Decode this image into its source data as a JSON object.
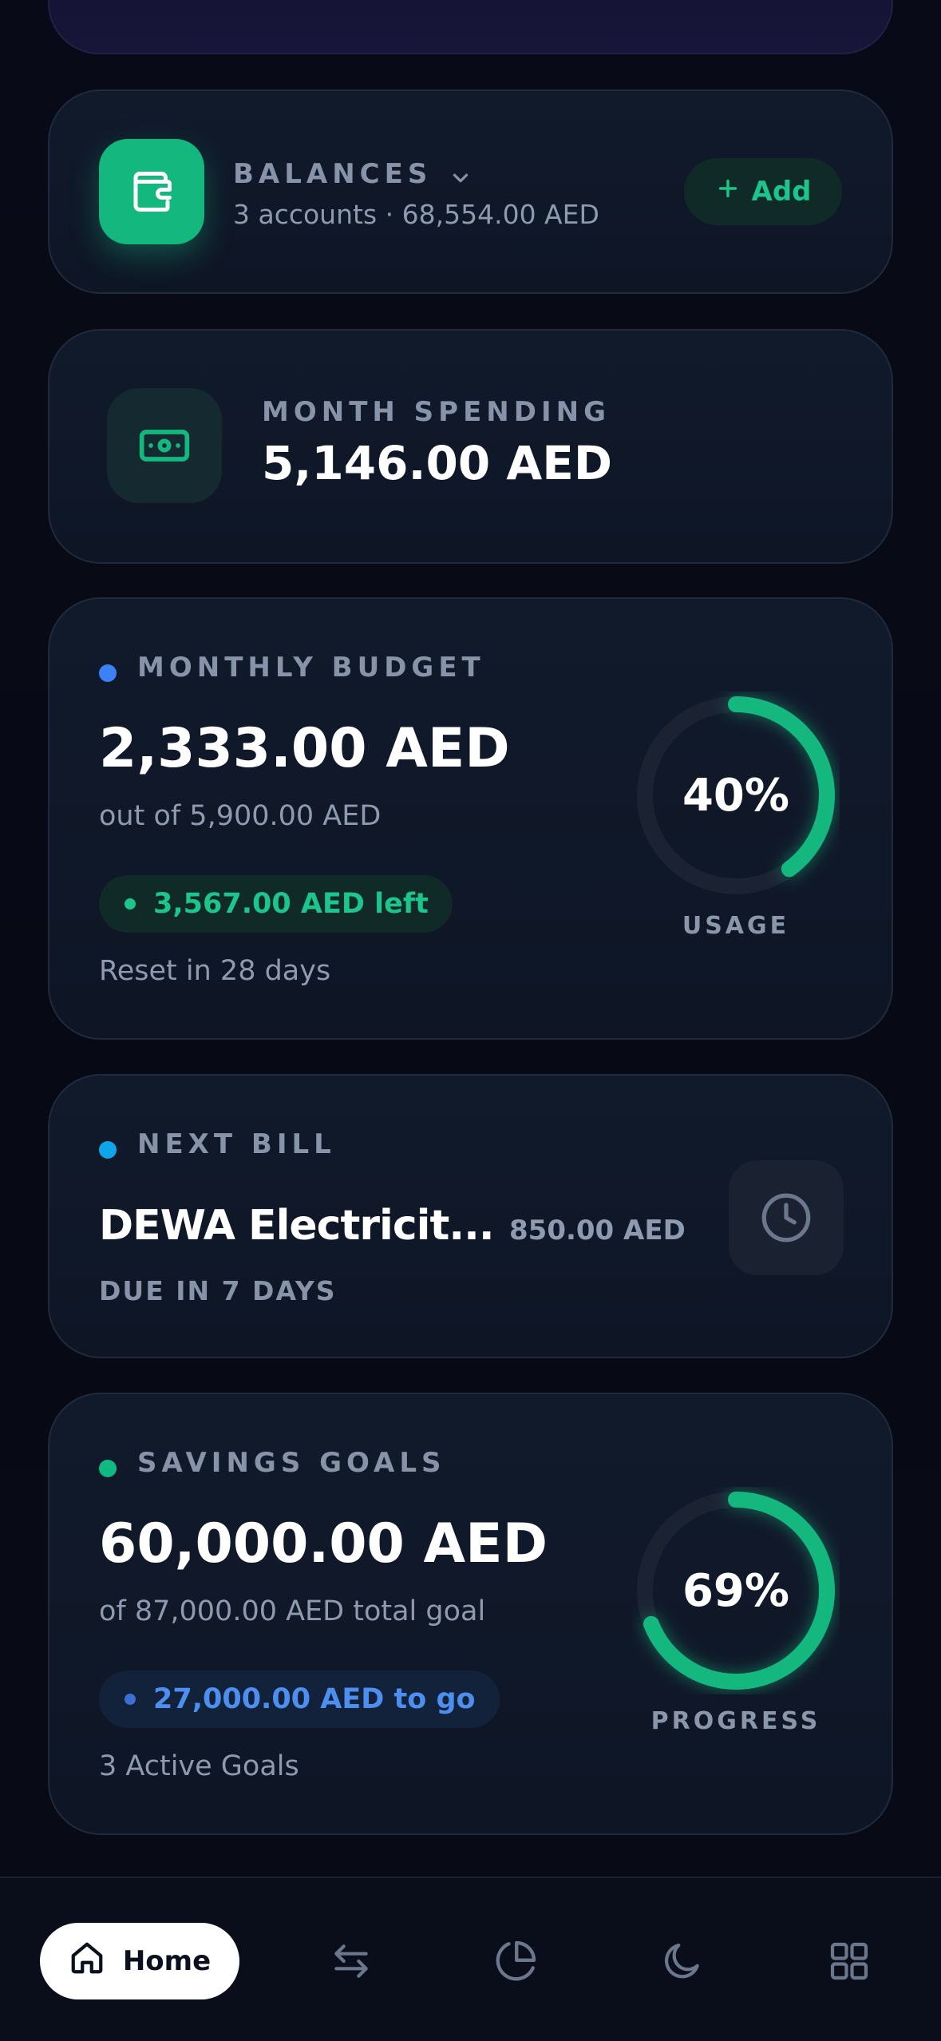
{
  "balances": {
    "title": "BALANCES",
    "subtitle": "3 accounts · 68,554.00 AED",
    "add_label": "Add"
  },
  "spending": {
    "title": "MONTH SPENDING",
    "amount": "5,146.00 AED"
  },
  "budget": {
    "title": "MONTHLY BUDGET",
    "amount": "2,333.00 AED",
    "subtitle": "out of 5,900.00 AED",
    "left_label": "3,567.00 AED left",
    "reset_label": "Reset in 28 days",
    "usage_percent_text": "40%",
    "usage_fraction": 0.4,
    "caption": "USAGE",
    "dot_color": "#3b82f6"
  },
  "bill": {
    "title": "NEXT BILL",
    "name": "DEWA Electricit...",
    "amount": "850.00 AED",
    "due": "DUE IN 7 DAYS",
    "dot_color": "#0ea5e9"
  },
  "savings": {
    "title": "SAVINGS GOALS",
    "amount": "60,000.00 AED",
    "subtitle": "of 87,000.00 AED total goal",
    "to_go_label": "27,000.00 AED to go",
    "active_goals": "3 Active Goals",
    "progress_percent_text": "69%",
    "progress_fraction": 0.69,
    "caption": "PROGRESS",
    "dot_color": "#10b981"
  },
  "nav": {
    "home_label": "Home",
    "items": [
      "home-icon",
      "transfer-icon",
      "pie-chart-icon",
      "moon-icon",
      "grid-icon"
    ]
  },
  "colors": {
    "accent": "#14b87e",
    "blue_text": "#4d8ff0",
    "background": "#070b16"
  }
}
